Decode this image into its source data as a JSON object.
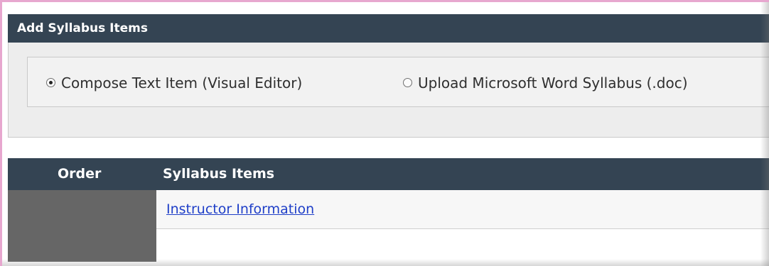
{
  "panel": {
    "title": "Add Syllabus Items",
    "options": [
      {
        "label": "Compose Text Item (Visual Editor)",
        "checked": true
      },
      {
        "label": "Upload Microsoft Word Syllabus (.doc)",
        "checked": false
      }
    ]
  },
  "table": {
    "headers": {
      "order": "Order",
      "items": "Syllabus Items"
    },
    "rows": [
      {
        "item": "Instructor Information"
      }
    ]
  },
  "colors": {
    "header_bg": "#344453",
    "link": "#1f3fc8",
    "frame": "#e7a7cf",
    "order_cell": "#666666"
  },
  "icons": [
    "radio-checked-icon",
    "radio-unchecked-icon"
  ]
}
